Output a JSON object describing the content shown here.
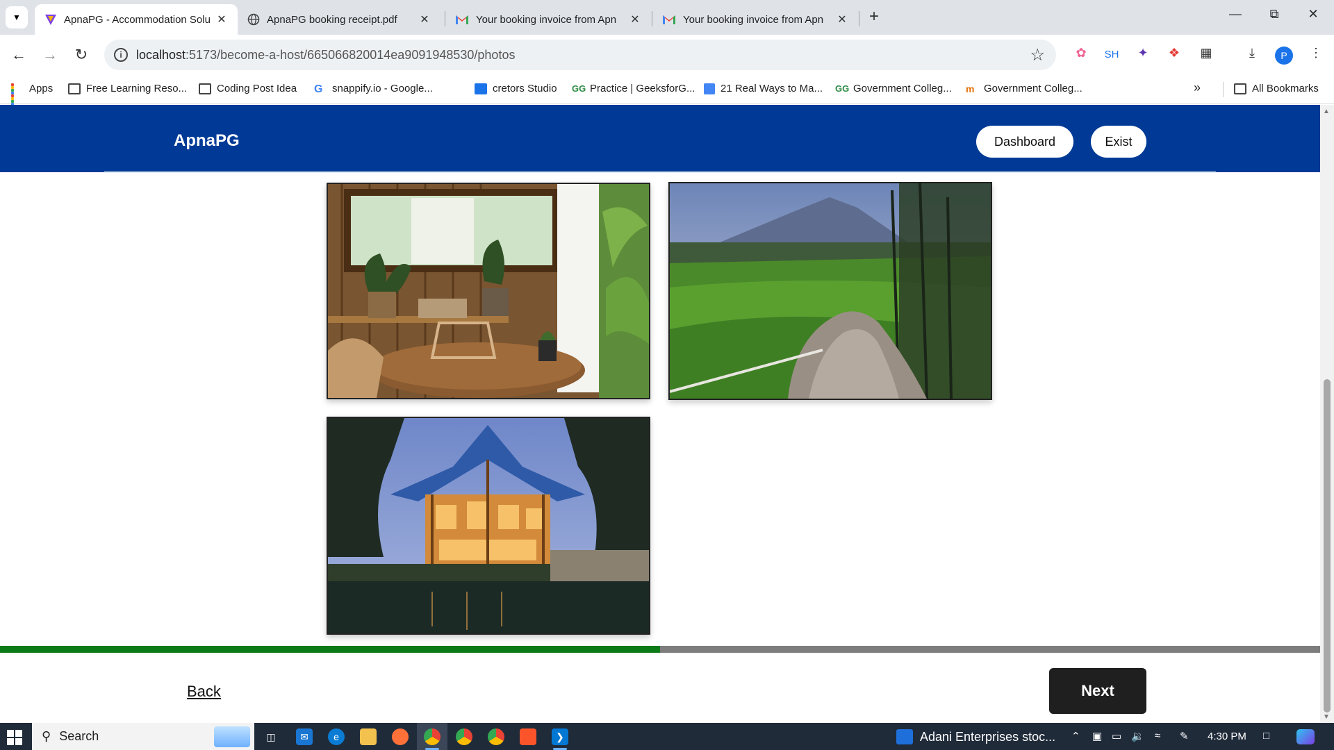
{
  "browser": {
    "tabs": [
      {
        "title": "ApnaPG - Accommodation Solu",
        "icon": "apnapg-favicon",
        "active": true
      },
      {
        "title": "ApnaPG booking receipt.pdf",
        "icon": "globe-icon",
        "active": false
      },
      {
        "title": "Your booking invoice from Apn",
        "icon": "gmail-icon",
        "active": false
      },
      {
        "title": "Your booking invoice from Apn",
        "icon": "gmail-icon",
        "active": false
      }
    ],
    "url_host": "localhost",
    "url_path": ":5173/become-a-host/665066820014ea9091948530/photos",
    "extension_sh": "SH",
    "profile_initial": "P"
  },
  "bookmarks": {
    "items": [
      {
        "label": "Apps"
      },
      {
        "label": "Free Learning Reso..."
      },
      {
        "label": "Coding Post Idea"
      },
      {
        "label": "snappify.io - Google..."
      },
      {
        "label": "cretors Studio"
      },
      {
        "label": "Practice | GeeksforG..."
      },
      {
        "label": "21 Real Ways to Ma..."
      },
      {
        "label": "Government Colleg..."
      },
      {
        "label": "Government Colleg..."
      }
    ],
    "more": "»",
    "all": "All Bookmarks"
  },
  "site": {
    "logo": "ApnaPG",
    "dashboard_label": "Dashboard",
    "exist_label": "Exist",
    "brand_color": "#003a96",
    "photos": [
      {
        "name": "bamboo-interior-photo"
      },
      {
        "name": "rice-terrace-photo"
      },
      {
        "name": "bamboo-house-photo"
      }
    ],
    "progress_fraction": 0.5,
    "back_label": "Back",
    "next_label": "Next"
  },
  "taskbar": {
    "search_label": "Search",
    "news": "Adani Enterprises stoc...",
    "time": "4:30 PM"
  }
}
